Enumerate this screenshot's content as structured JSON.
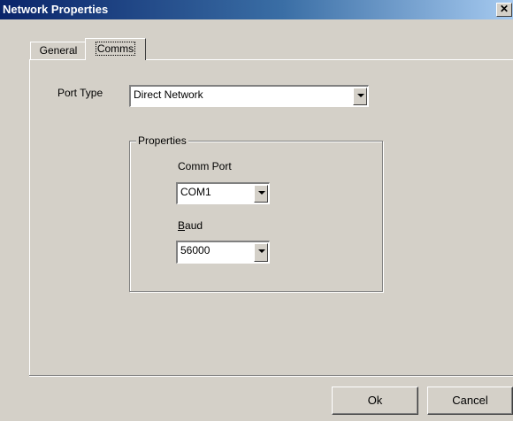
{
  "window": {
    "title": "Network Properties",
    "close_glyph": "✕"
  },
  "tabs": [
    {
      "label": "General"
    },
    {
      "label": "Comms",
      "selected": true
    }
  ],
  "port_type": {
    "label": "Port Type",
    "value": "Direct Network"
  },
  "properties": {
    "group_label": "Properties",
    "comm_port": {
      "label": "Comm Port",
      "value": "COM1"
    },
    "baud": {
      "label": "Baud",
      "value": "56000"
    }
  },
  "buttons": {
    "ok": "Ok",
    "cancel": "Cancel"
  }
}
